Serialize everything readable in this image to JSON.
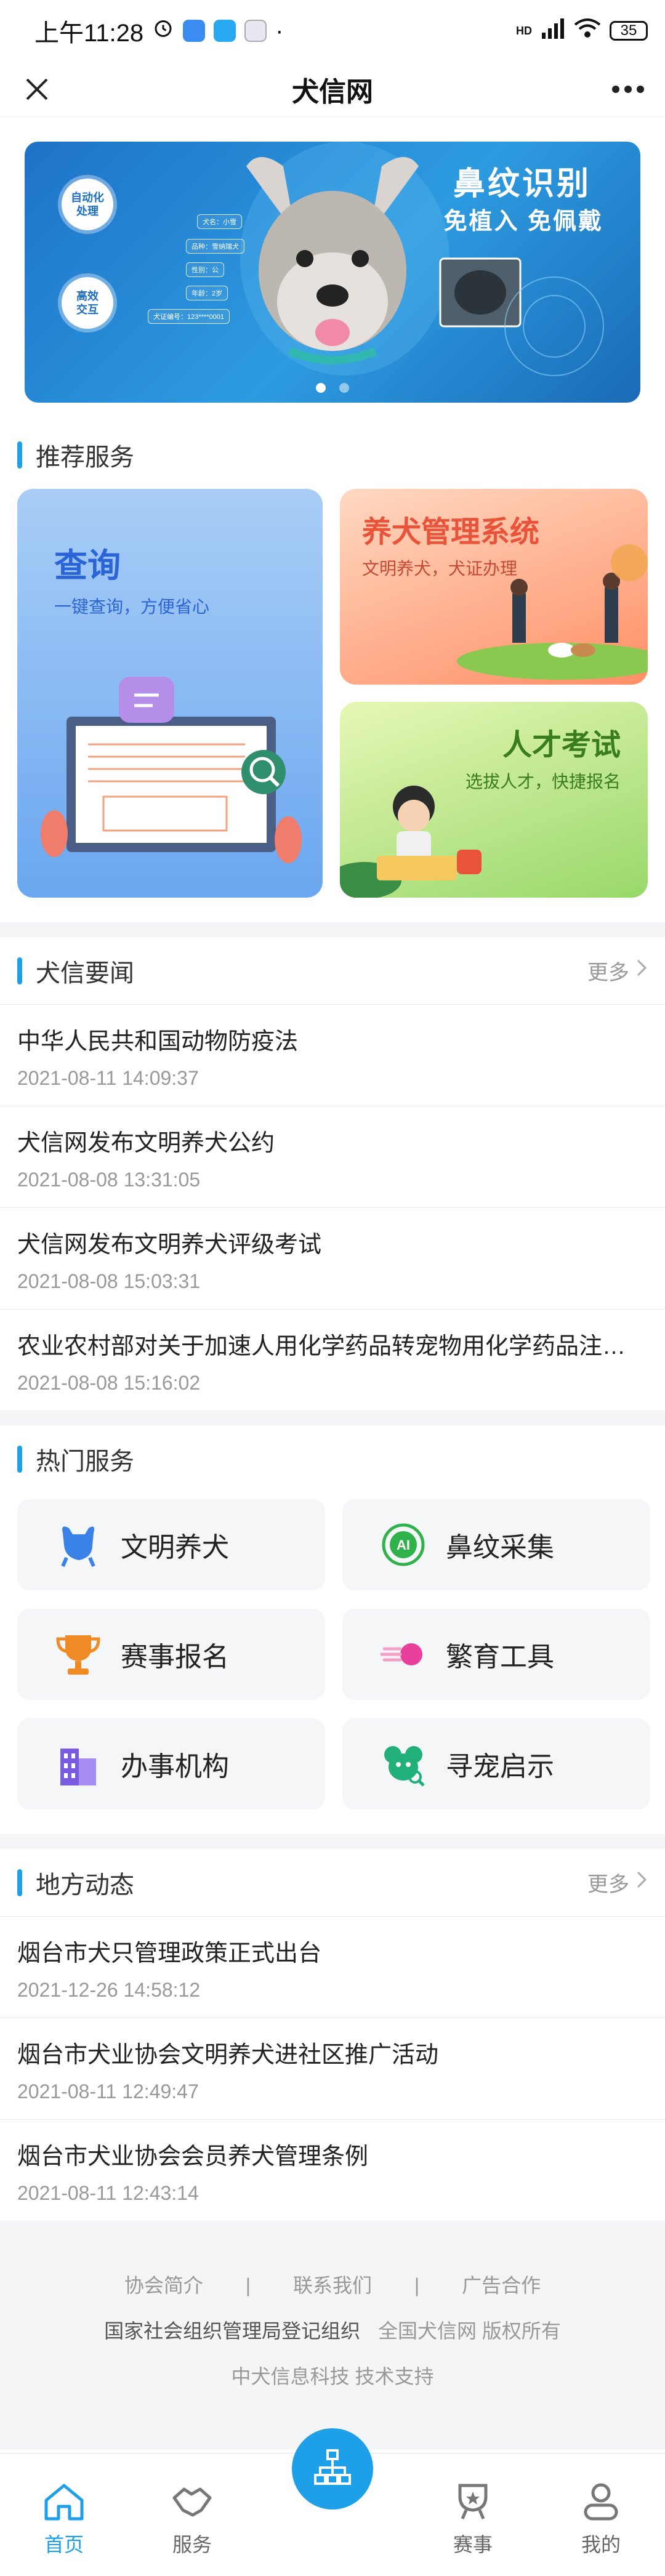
{
  "status_bar": {
    "time": "上午11:28",
    "battery": "35",
    "network": "HD"
  },
  "nav": {
    "title": "犬信网"
  },
  "banner": {
    "title": "鼻纹识别",
    "subtitle": "免植入  免佩戴",
    "badges": [
      "自动化\n处理",
      "高效\n交互"
    ],
    "tags": [
      "犬名：小雪",
      "品种：雪纳瑞犬",
      "性别：公",
      "年龄：2岁",
      "犬证编号：123****0001"
    ],
    "slides": 2,
    "active_slide": 1
  },
  "recommend": {
    "title": "推荐服务",
    "query": {
      "title": "查询",
      "subtitle": "一键查询，方便省心"
    },
    "management": {
      "title": "养犬管理系统",
      "subtitle": "文明养犬，犬证办理"
    },
    "talent": {
      "title": "人才考试",
      "subtitle": "选拔人才，快捷报名"
    }
  },
  "news": {
    "title": "犬信要闻",
    "more": "更多",
    "items": [
      {
        "title": "中华人民共和国动物防疫法",
        "date": "2021-08-11 14:09:37"
      },
      {
        "title": "犬信网发布文明养犬公约",
        "date": "2021-08-08 13:31:05"
      },
      {
        "title": "犬信网发布文明养犬评级考试",
        "date": "2021-08-08 15:03:31"
      },
      {
        "title": "农业农村部对关于加速人用化学药品转宠物用化学药品注册…",
        "date": "2021-08-08 15:16:02"
      }
    ]
  },
  "hot": {
    "title": "热门服务",
    "items": [
      {
        "label": "文明养犬",
        "icon": "dog-icon",
        "color": "#3b82e8"
      },
      {
        "label": "鼻纹采集",
        "icon": "ai-icon",
        "color": "#2fb24a"
      },
      {
        "label": "赛事报名",
        "icon": "trophy-icon",
        "color": "#f08a24"
      },
      {
        "label": "繁育工具",
        "icon": "breeding-icon",
        "color": "#e8409a"
      },
      {
        "label": "办事机构",
        "icon": "building-icon",
        "color": "#7a5ce0"
      },
      {
        "label": "寻宠启示",
        "icon": "pet-search-icon",
        "color": "#22b07a"
      }
    ]
  },
  "local": {
    "title": "地方动态",
    "more": "更多",
    "items": [
      {
        "title": "烟台市犬只管理政策正式出台",
        "date": "2021-12-26 14:58:12"
      },
      {
        "title": "烟台市犬业协会文明养犬进社区推广活动",
        "date": "2021-08-11 12:49:47"
      },
      {
        "title": "烟台市犬业协会会员养犬管理条例",
        "date": "2021-08-11 12:43:14"
      }
    ]
  },
  "footer": {
    "links": [
      "协会简介",
      "联系我们",
      "广告合作"
    ],
    "separator": "|",
    "line2_a": "国家社会组织管理局登记组织",
    "line2_b": "全国犬信网 版权所有",
    "line3": "中犬信息科技 技术支持"
  },
  "tabbar": {
    "items": [
      {
        "label": "首页",
        "icon": "home-icon",
        "active": true
      },
      {
        "label": "服务",
        "icon": "handshake-icon",
        "active": false
      },
      {
        "label": "",
        "icon": "org-chart-icon",
        "active": false
      },
      {
        "label": "赛事",
        "icon": "medal-icon",
        "active": false
      },
      {
        "label": "我的",
        "icon": "user-icon",
        "active": false
      }
    ]
  },
  "colors": {
    "accent": "#1ea0e8"
  }
}
